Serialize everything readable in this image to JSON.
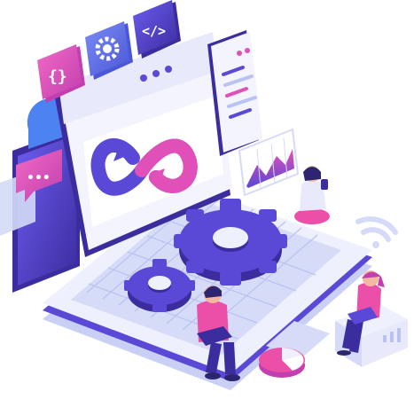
{
  "illustration": {
    "scene": "devops-laptop-isometric",
    "icons": {
      "top_tiles": [
        "curly-braces-icon",
        "gear-icon",
        "code-tag-icon"
      ],
      "chat": "speech-bubble-icon",
      "wifi": "wifi-icon",
      "chart": "area-chart-icon",
      "infinity": "infinity-loop-icon"
    },
    "glyphs": {
      "braces": "{}",
      "code": "</>",
      "dots": "•••"
    },
    "colors": {
      "purple_dark": "#3b2d9e",
      "purple": "#5a48d6",
      "violet": "#6d5cf0",
      "pink": "#e14fb8",
      "magenta": "#ec4fa8",
      "light_lavender": "#e8eafc",
      "pale_blue": "#d4daf7",
      "white": "#ffffff"
    }
  }
}
